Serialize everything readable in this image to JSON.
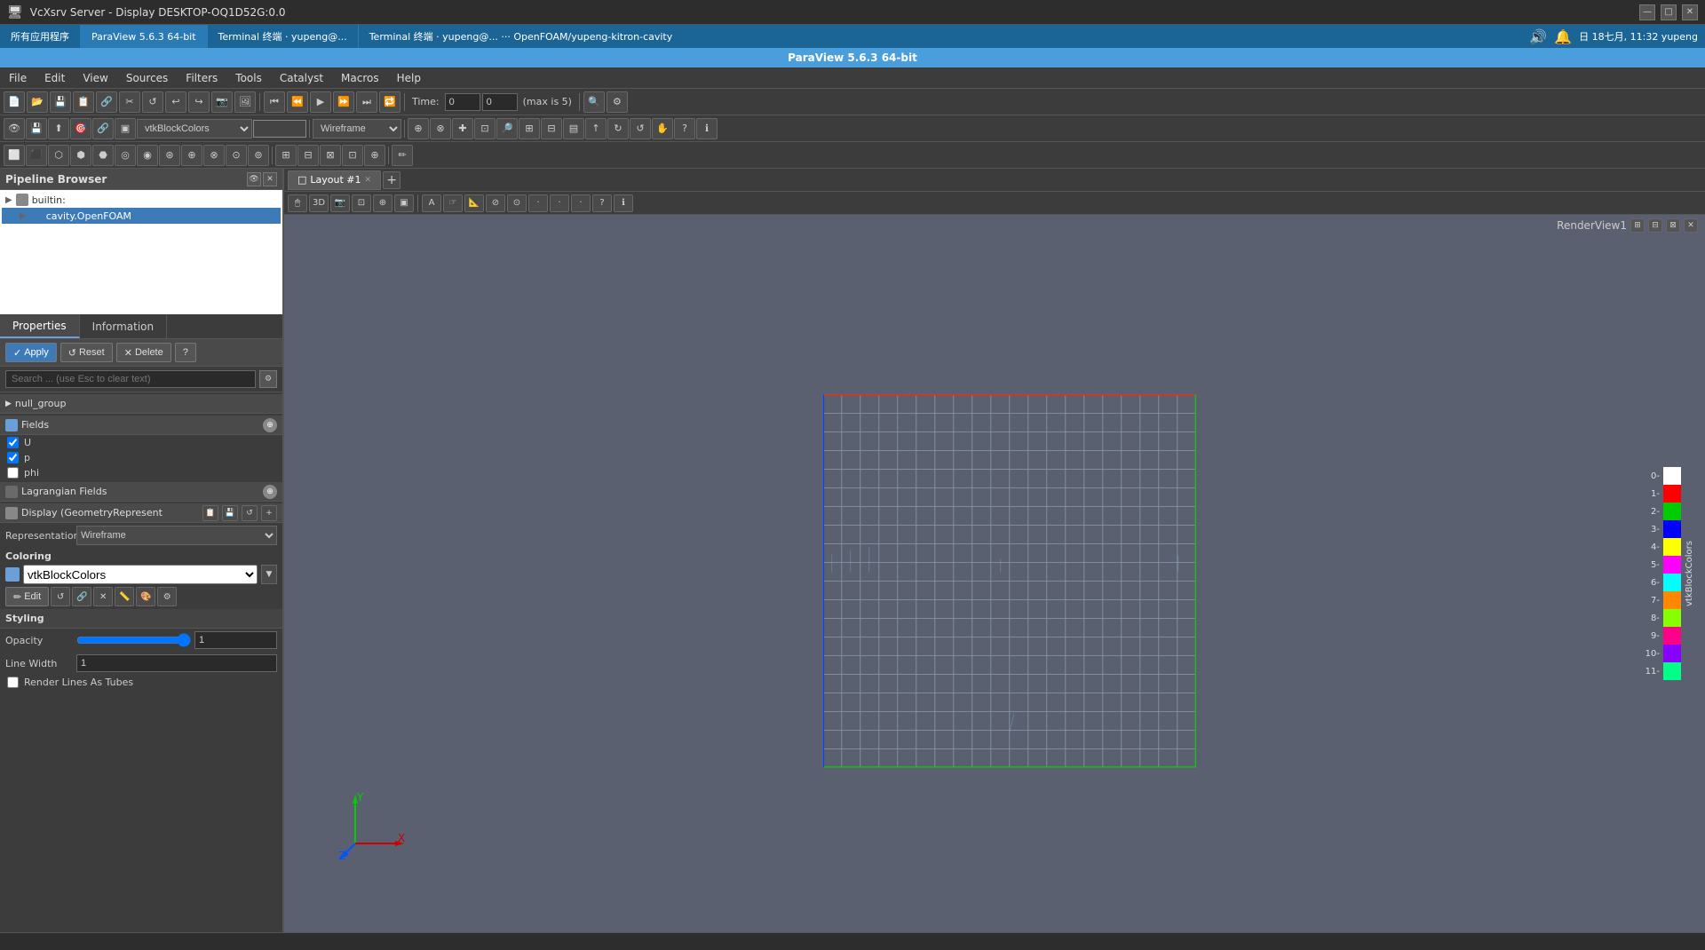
{
  "titlebar": {
    "title": "VcXsrv Server - Display DESKTOP-OQ1D52G:0.0",
    "minimize": "—",
    "maximize": "□",
    "close": "✕"
  },
  "taskbar": {
    "items": [
      {
        "label": "所有应用程序",
        "active": false
      },
      {
        "label": "ParaView 5.6.3 64-bit",
        "active": true
      },
      {
        "label": "Terminal 终端 · yupeng@...",
        "active": false
      },
      {
        "label": "Terminal 终端 · yupeng@...  ···  OpenFOAM/yupeng-kitron-cavity",
        "active": false
      }
    ],
    "window_title": "ParaView 5.6.3 64-bit",
    "datetime": "日 18七月, 11:32  yupeng"
  },
  "menubar": {
    "items": [
      "File",
      "Edit",
      "View",
      "Sources",
      "Filters",
      "Tools",
      "Catalyst",
      "Macros",
      "Help"
    ]
  },
  "toolbar1": {
    "time_label": "Time:",
    "time_value": "0",
    "time_input": "0",
    "time_max": "(max is 5)"
  },
  "toolbar2": {
    "coloring_select": "vtkBlockColors",
    "representation_select": "Wireframe"
  },
  "pipeline": {
    "title": "Pipeline Browser",
    "items": [
      {
        "label": "builtin:",
        "indent": 0,
        "selected": false
      },
      {
        "label": "cavity.OpenFOAM",
        "indent": 1,
        "selected": true
      }
    ]
  },
  "properties": {
    "title": "Properties",
    "tabs": [
      "Properties",
      "Information"
    ],
    "active_tab": "Properties",
    "buttons": {
      "apply": "Apply",
      "reset": "Reset",
      "delete": "Delete",
      "help": "?"
    },
    "search_placeholder": "Search ... (use Esc to clear text)",
    "sections": {
      "null_group": "null_group",
      "fields": {
        "title": "Fields",
        "items": [
          {
            "label": "U",
            "checked": true
          },
          {
            "label": "p",
            "checked": true
          },
          {
            "label": "phi",
            "checked": false
          }
        ]
      },
      "lagrangian": {
        "title": "Lagrangian Fields"
      },
      "display": {
        "title": "Display (GeometryRepresent"
      }
    },
    "representation": {
      "label": "Representation",
      "value": "Wireframe"
    },
    "coloring": {
      "label": "Coloring",
      "value": "vtkBlockColors",
      "edit_btn": "Edit"
    },
    "styling": {
      "label": "Styling"
    },
    "opacity": {
      "label": "Opacity",
      "value": "1"
    },
    "line_width": {
      "label": "Line Width",
      "value": "1"
    },
    "render_lines": {
      "label": "Render Lines As Tubes",
      "checked": false
    }
  },
  "viewport": {
    "tab_label": "Layout #1",
    "render_label": "RenderView1"
  },
  "color_legend": {
    "title": "vtkBlockColors",
    "items": [
      {
        "num": "0-",
        "color": "#ffffff"
      },
      {
        "num": "1-",
        "color": "#ff0000"
      },
      {
        "num": "2-",
        "color": "#00cc00"
      },
      {
        "num": "3-",
        "color": "#0000ff"
      },
      {
        "num": "4-",
        "color": "#ffff00"
      },
      {
        "num": "5-",
        "color": "#ff00ff"
      },
      {
        "num": "6-",
        "color": "#00ffff"
      },
      {
        "num": "7-",
        "color": "#ff8800"
      },
      {
        "num": "8-",
        "color": "#88ff00"
      },
      {
        "num": "9-",
        "color": "#ff0088"
      },
      {
        "num": "10-",
        "color": "#8800ff"
      },
      {
        "num": "11-",
        "color": "#00ff88"
      }
    ]
  }
}
